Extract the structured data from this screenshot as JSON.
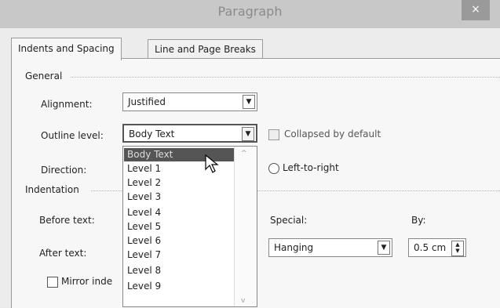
{
  "window": {
    "title": "Paragraph",
    "close_glyph": "×"
  },
  "tabs": [
    {
      "label": "Indents and Spacing",
      "active": true
    },
    {
      "label": "Line and Page Breaks",
      "active": false
    }
  ],
  "general": {
    "heading": "General",
    "alignment_label": "Alignment:",
    "alignment_value": "Justified",
    "outline_label": "Outline level:",
    "outline_value": "Body Text",
    "collapsed_label": "Collapsed by default",
    "direction_label": "Direction:",
    "direction_option": "Left-to-right"
  },
  "indentation": {
    "heading": "Indentation",
    "before_label": "Before text:",
    "after_label": "After text:",
    "special_label": "Special:",
    "special_value": "Hanging",
    "by_label": "By:",
    "by_value": "0.5 cm",
    "mirror_label": "Mirror inde"
  },
  "outline_dropdown": {
    "items": [
      "Body Text",
      "Level 1",
      "Level 2",
      "Level 3",
      "Level 4",
      "Level 5",
      "Level 6",
      "Level 7",
      "Level 8",
      "Level 9"
    ],
    "selected_index": 0
  },
  "icons": {
    "dropdown_arrow": "chevron-down-icon",
    "spin": "spin-arrows-icon",
    "cursor": "mouse-pointer-icon"
  }
}
